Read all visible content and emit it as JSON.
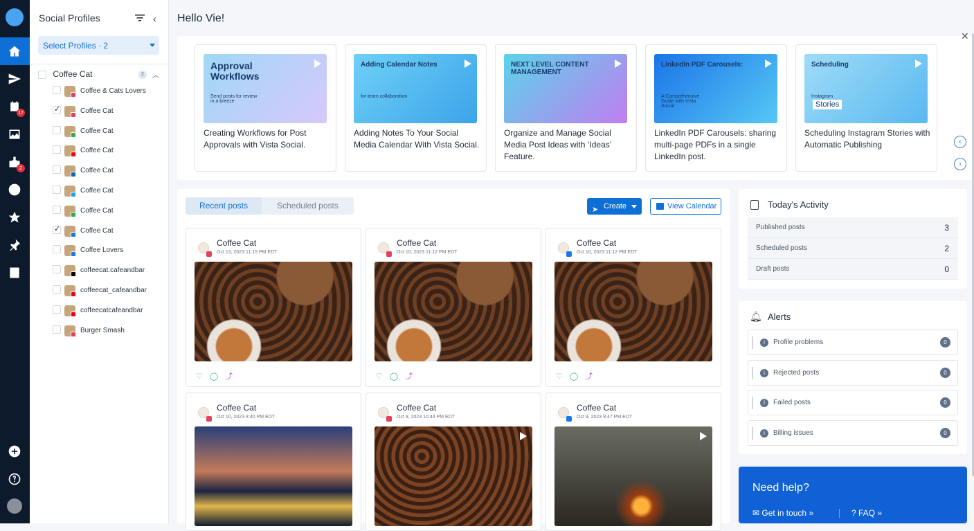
{
  "sidebar": {
    "title": "Social Profiles",
    "select_label": "Select Profiles · 2",
    "group": {
      "name": "Coffee Cat",
      "count": "2"
    },
    "profiles": [
      {
        "name": "Coffee & Cats Lovers",
        "checked": false,
        "network_color": "#e4405f"
      },
      {
        "name": "Coffee Cat",
        "checked": true,
        "network_color": "#e4405f"
      },
      {
        "name": "Coffee Cat",
        "checked": false,
        "network_color": "#34a853"
      },
      {
        "name": "Coffee Cat",
        "checked": false,
        "network_color": "#ff0000"
      },
      {
        "name": "Coffee Cat",
        "checked": false,
        "network_color": "#0a66c2"
      },
      {
        "name": "Coffee Cat",
        "checked": false,
        "network_color": "#1da1f2"
      },
      {
        "name": "Coffee Cat",
        "checked": false,
        "network_color": "#34a853"
      },
      {
        "name": "Coffee Cat",
        "checked": true,
        "network_color": "#1877f2"
      },
      {
        "name": "Coffee Lovers",
        "checked": false,
        "network_color": "#1877f2"
      },
      {
        "name": "coffeecat.cafeandbar",
        "checked": false,
        "network_color": "#000000"
      },
      {
        "name": "coffeecat_cafeandbar",
        "checked": false,
        "network_color": "#e60023"
      },
      {
        "name": "coffeecatcafeandbar",
        "checked": false,
        "network_color": "#e60023"
      },
      {
        "name": "Burger Smash",
        "checked": false,
        "network_color": "#e4405f"
      }
    ]
  },
  "rail": {
    "calendar_badge": "17",
    "inbox_badge": "2"
  },
  "header": {
    "greeting": "Hello Vie!"
  },
  "carousel": [
    {
      "title": "Creating Workflows for Post Approvals with Vista Social.",
      "thumb_text": "Approval Workflows",
      "thumb_sub": "Send posts for review in a breeze"
    },
    {
      "title": "Adding Notes To Your Social Media Calendar With Vista Social.",
      "thumb_text": "Adding Calendar Notes",
      "thumb_sub": "for team collaboration"
    },
    {
      "title": "Organize and Manage Social Media Post Ideas with ‘Ideas’ Feature.",
      "thumb_text": "NEXT LEVEL CONTENT MANAGEMENT",
      "thumb_sub": ""
    },
    {
      "title": "LinkedIn PDF Carousels: sharing multi-page PDFs in a single LinkedIn post.",
      "thumb_text": "LinkedIn PDF Carousels:",
      "thumb_sub": "A Comprehensive Guide with Vista Social"
    },
    {
      "title": "Scheduling Instagram Stories with Automatic Publishing",
      "thumb_text": "Scheduling",
      "thumb_sub": "Instagram",
      "thumb_sub2": "Stories"
    }
  ],
  "posts_panel": {
    "tabs": [
      "Recent posts",
      "Scheduled posts"
    ],
    "create_label": "Create",
    "calendar_label": "View Calendar",
    "posts": [
      {
        "name": "Coffee Cat",
        "date": "Oct 13, 2023 11:15 PM EDT",
        "network_color": "#e4405f",
        "image": "coffee"
      },
      {
        "name": "Coffee Cat",
        "date": "Oct 10, 2023 11:12 PM EDT",
        "network_color": "#e4405f",
        "image": "coffee"
      },
      {
        "name": "Coffee Cat",
        "date": "Oct 10, 2023 11:12 PM EDT",
        "network_color": "#1877f2",
        "image": "coffee"
      },
      {
        "name": "Coffee Cat",
        "date": "Oct 10, 2023 8:40 PM EDT",
        "network_color": "#e4405f",
        "image": "city"
      },
      {
        "name": "Coffee Cat",
        "date": "Oct 9, 2023 10:44 PM EDT",
        "network_color": "#e4405f",
        "image": "beans"
      },
      {
        "name": "Coffee Cat",
        "date": "Oct 9, 2023 9:47 PM EDT",
        "network_color": "#1877f2",
        "image": "fire"
      }
    ]
  },
  "activity": {
    "title": "Today's Activity",
    "rows": [
      {
        "label": "Published posts",
        "value": "3"
      },
      {
        "label": "Scheduled posts",
        "value": "2"
      },
      {
        "label": "Draft posts",
        "value": "0"
      }
    ]
  },
  "alerts": {
    "title": "Alerts",
    "rows": [
      {
        "label": "Profile problems",
        "value": "0"
      },
      {
        "label": "Rejected posts",
        "value": "0"
      },
      {
        "label": "Failed posts",
        "value": "0"
      },
      {
        "label": "Billing issues",
        "value": "0"
      }
    ]
  },
  "help": {
    "title": "Need help?",
    "contact": "Get in touch",
    "faq": "FAQ"
  }
}
